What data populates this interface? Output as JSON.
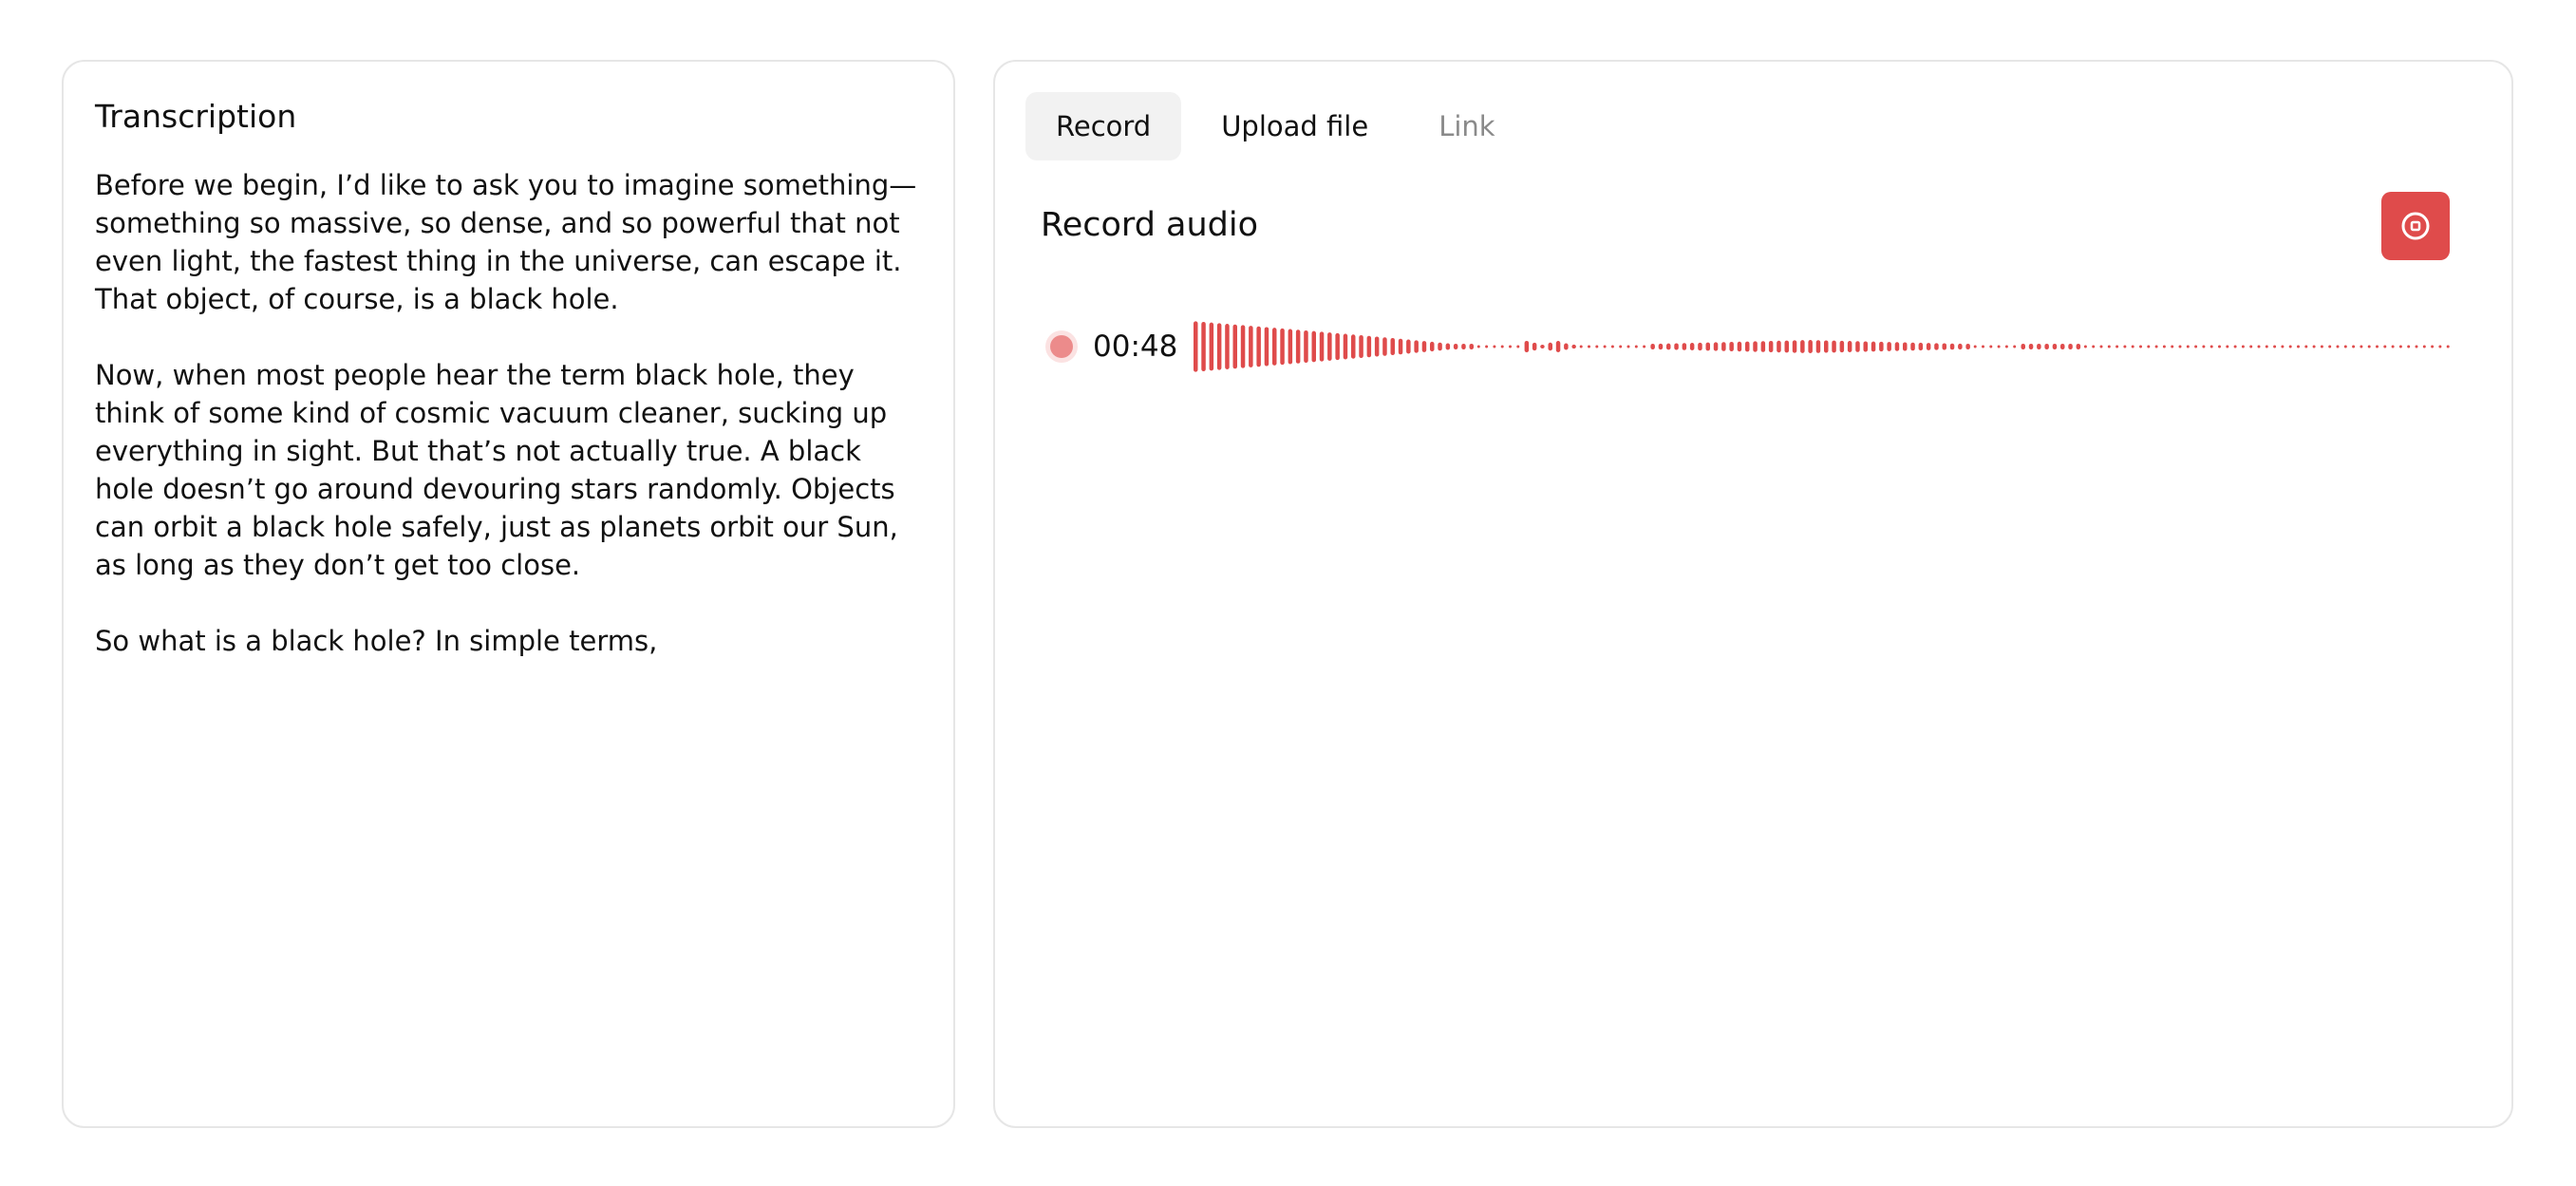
{
  "transcription": {
    "title": "Transcription",
    "paragraphs": [
      "Before we begin, I’d like to ask you to imagine something—something so massive, so dense, and so powerful that not even light, the fastest thing in the universe, can escape it. That object, of course, is a black hole.",
      "Now, when most people hear the term black hole, they think of some kind of cosmic vacuum cleaner, sucking up everything in sight. But that’s not actually true. A black hole doesn’t go around devouring stars randomly. Objects can orbit a black hole safely, just as planets orbit our Sun, as long as they don’t get too close.",
      "So what is a black hole? In simple terms,"
    ]
  },
  "recorder": {
    "tabs": [
      {
        "label": "Record",
        "state": "active"
      },
      {
        "label": "Upload file",
        "state": "normal"
      },
      {
        "label": "Link",
        "state": "disabled"
      }
    ],
    "title": "Record audio",
    "stop_button_icon": "stop-record-icon",
    "recording_indicator_icon": "recording-dot-icon",
    "timer": "00:48",
    "colors": {
      "accent": "#df4b4b",
      "waveform": "#df4b4b",
      "indicator_dot": "#ec8b8b",
      "active_tab_bg": "#f2f2f2",
      "muted_text": "#8a8a8a"
    }
  }
}
